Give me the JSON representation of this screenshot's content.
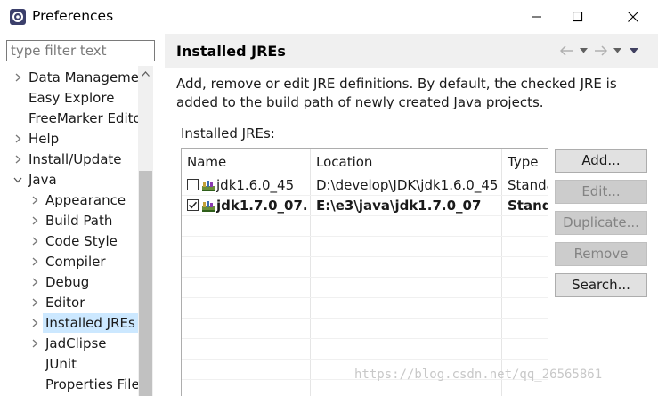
{
  "window": {
    "title": "Preferences",
    "icon": "eclipse-preferences-icon",
    "controls": [
      "minimize-icon",
      "maximize-icon",
      "close-icon"
    ]
  },
  "left": {
    "filter_placeholder": "type filter text",
    "tree": [
      {
        "label": "Data Manageme",
        "twisty": "collapsed",
        "level": 0
      },
      {
        "label": "Easy Explore",
        "twisty": "none",
        "level": 0
      },
      {
        "label": "FreeMarker Edito",
        "twisty": "none",
        "level": 0
      },
      {
        "label": "Help",
        "twisty": "collapsed",
        "level": 0
      },
      {
        "label": "Install/Update",
        "twisty": "collapsed",
        "level": 0
      },
      {
        "label": "Java",
        "twisty": "expanded",
        "level": 0
      },
      {
        "label": "Appearance",
        "twisty": "collapsed",
        "level": 1
      },
      {
        "label": "Build Path",
        "twisty": "collapsed",
        "level": 1
      },
      {
        "label": "Code Style",
        "twisty": "collapsed",
        "level": 1
      },
      {
        "label": "Compiler",
        "twisty": "collapsed",
        "level": 1
      },
      {
        "label": "Debug",
        "twisty": "collapsed",
        "level": 1
      },
      {
        "label": "Editor",
        "twisty": "collapsed",
        "level": 1
      },
      {
        "label": "Installed JREs",
        "twisty": "collapsed",
        "level": 1,
        "selected": true
      },
      {
        "label": "JadClipse",
        "twisty": "collapsed",
        "level": 1
      },
      {
        "label": "JUnit",
        "twisty": "none",
        "level": 1
      },
      {
        "label": "Properties File",
        "twisty": "none",
        "level": 1
      }
    ]
  },
  "right": {
    "title": "Installed JREs",
    "description": "Add, remove or edit JRE definitions. By default, the checked JRE is added to the build path of newly created Java projects.",
    "list_label": "Installed JREs:",
    "columns": [
      "Name",
      "Location",
      "Type"
    ],
    "rows": [
      {
        "checked": false,
        "name": "jdk1.6.0_45",
        "location": "D:\\develop\\JDK\\jdk1.6.0_45",
        "type": "Standa",
        "bold": false
      },
      {
        "checked": true,
        "name": "jdk1.7.0_07...",
        "location": "E:\\e3\\java\\jdk1.7.0_07",
        "type": "Stand",
        "bold": true
      }
    ],
    "buttons": [
      {
        "label": "Add...",
        "enabled": true
      },
      {
        "label": "Edit...",
        "enabled": false
      },
      {
        "label": "Duplicate...",
        "enabled": false
      },
      {
        "label": "Remove",
        "enabled": false
      },
      {
        "label": "Search...",
        "enabled": true
      }
    ]
  },
  "watermark": "https://blog.csdn.net/qq_26565861",
  "colors": {
    "selection": "#cce8ff",
    "header_bg": "#f0f0f0",
    "button_bg": "#e1e1e1",
    "disabled_button_bg": "#cccccc"
  }
}
